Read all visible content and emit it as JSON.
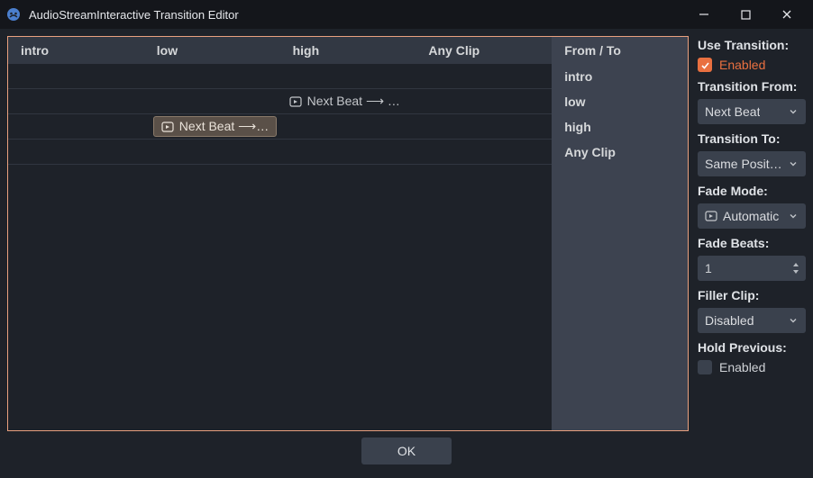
{
  "title": "AudioStreamInteractive Transition Editor",
  "columns": [
    "intro",
    "low",
    "high",
    "Any Clip"
  ],
  "side_header": "From / To",
  "row_labels": [
    "intro",
    "low",
    "high",
    "Any Clip"
  ],
  "cells": {
    "row1_col2_label": "Next Beat ⟶ …",
    "row2_col1_label": "Next Beat ⟶…"
  },
  "sidebar": {
    "use_transition": "Use Transition:",
    "use_transition_enabled_label": "Enabled",
    "transition_from": "Transition From:",
    "transition_from_value": "Next Beat",
    "transition_to": "Transition To:",
    "transition_to_value": "Same Position",
    "fade_mode": "Fade Mode:",
    "fade_mode_value": "Automatic",
    "fade_beats": "Fade Beats:",
    "fade_beats_value": "1",
    "filler_clip": "Filler Clip:",
    "filler_clip_value": "Disabled",
    "hold_previous": "Hold Previous:",
    "hold_previous_label": "Enabled"
  },
  "footer": {
    "ok": "OK"
  }
}
